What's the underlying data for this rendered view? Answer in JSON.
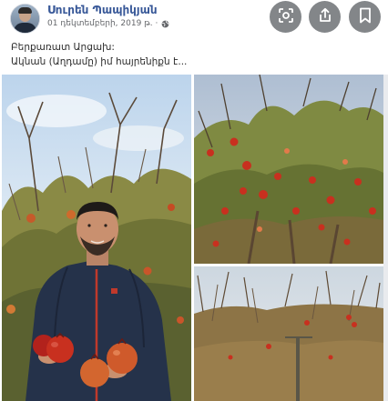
{
  "post": {
    "author": "Սուրեն Պապիկյան",
    "date": "01 դեկտեմբերի, 2019 թ. ·",
    "text_line1": "Բերքառատ Արցախ:",
    "text_line2": "Ակնան (Աղդամը) իմ հայրենիքն է...",
    "privacy_icon": "globe-icon"
  },
  "actions": [
    {
      "name": "scan-button",
      "icon": "scan-icon"
    },
    {
      "name": "share-button",
      "icon": "share-icon"
    },
    {
      "name": "save-button",
      "icon": "bookmark-icon"
    }
  ],
  "photos": [
    {
      "name": "photo-man-with-pomegranates"
    },
    {
      "name": "photo-pomegranate-tree"
    },
    {
      "name": "photo-pomegranate-orchard"
    }
  ],
  "colors": {
    "author_link": "#385898",
    "button_bg": "#838689",
    "pomegranate_red": "#c8301f"
  }
}
